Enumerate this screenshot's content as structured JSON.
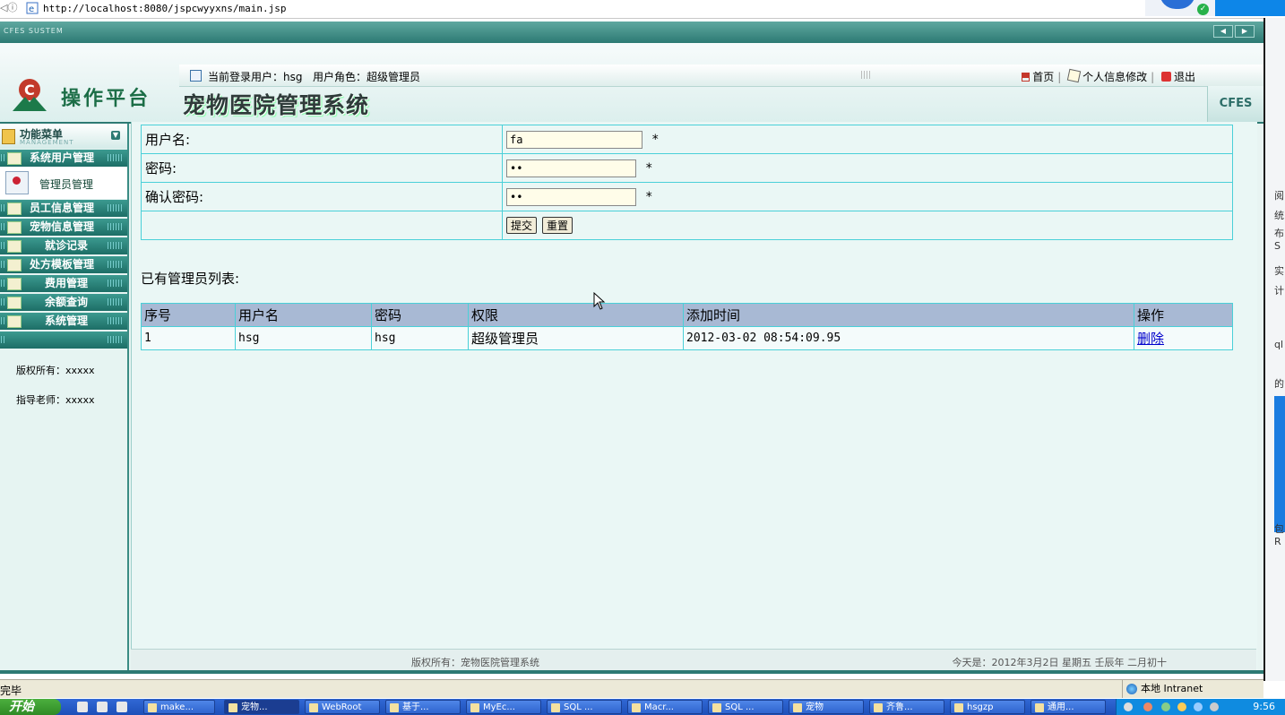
{
  "browser": {
    "url": "http://localhost:8080/jspcwyyxns/main.jsp"
  },
  "titlebar": {
    "system_label": "CFES SUSTEM"
  },
  "header": {
    "platform_title": "操作平台",
    "system_title": "宠物医院管理系统",
    "current_user_label": "当前登录用户：hsg",
    "user_role_label": "用户角色：超级管理员",
    "links": {
      "home": "首页",
      "profile": "个人信息修改",
      "logout": "退出"
    },
    "brand": "CFES"
  },
  "sidebar": {
    "menu_title": "功能菜单",
    "menu_subtitle": "MANAGEMENT",
    "items": [
      {
        "label": "系统用户管理"
      },
      {
        "label": "员工信息管理"
      },
      {
        "label": "宠物信息管理"
      },
      {
        "label": "就诊记录"
      },
      {
        "label": "处方模板管理"
      },
      {
        "label": "费用管理"
      },
      {
        "label": "余额查询"
      },
      {
        "label": "系统管理"
      }
    ],
    "subitem": "管理员管理",
    "copyright": "版权所有：xxxxx",
    "teacher": "指导老师：xxxxx"
  },
  "form": {
    "username_label": "用户名:",
    "username_value": "fa",
    "password_label": "密码:",
    "password_value": "••",
    "confirm_label": "确认密码:",
    "confirm_value": "••",
    "required_mark": "*",
    "submit_label": "提交",
    "reset_label": "重置"
  },
  "list": {
    "title": "已有管理员列表:",
    "columns": [
      "序号",
      "用户名",
      "密码",
      "权限",
      "添加时间",
      "操作"
    ],
    "rows": [
      {
        "no": "1",
        "username": "hsg",
        "password": "hsg",
        "role": "超级管理员",
        "added": "2012-03-02 08:54:09.95",
        "action": "删除"
      }
    ]
  },
  "footer": {
    "copyright": "版权所有：宠物医院管理系统",
    "date": "今天是：2012年3月2日 星期五 壬辰年 二月初十"
  },
  "statusbar": {
    "left": "完毕",
    "zone": "本地 Intranet"
  },
  "taskbar": {
    "start": "开始",
    "tasks": [
      "make...",
      "宠物...",
      "WebRoot",
      "基于...",
      "MyEc...",
      "SQL ...",
      "Macr...",
      "SQL ...",
      "宠物",
      "齐鲁...",
      "hsgzp",
      "通用..."
    ],
    "time": "9:56"
  },
  "right_edge": {
    "fragments": [
      "阅",
      "统",
      "布S",
      "实",
      "计",
      "ql",
      "的",
      "包R"
    ]
  }
}
